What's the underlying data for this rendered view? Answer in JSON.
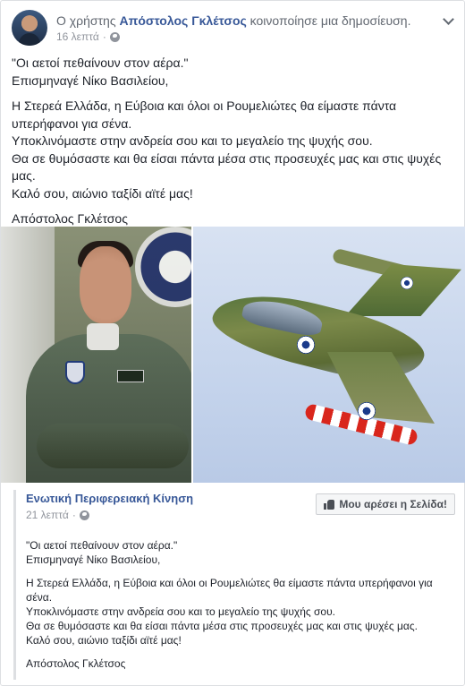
{
  "post": {
    "prefix": "Ο χρήστης ",
    "author": "Απόστολος Γκλέτσος",
    "action": " κοινοποίησε μια δημοσίευση.",
    "time": "16 λεπτά",
    "dot": "·",
    "paragraphs": [
      [
        "\"Οι αετοί πεθαίνουν στον αέρα.\"",
        "Επισμηναγέ Νίκο Βασιλείου,"
      ],
      [
        "Η Στερεά Ελλάδα, η Εύβοια και όλοι οι Ρουμελιώτες θα είμαστε πάντα",
        "υπερήφανοι για σένα.",
        "Υποκλινόμαστε στην ανδρεία σου και το μεγαλείο της ψυχής σου.",
        "Θα σε θυμόσαστε και θα είσαι πάντα μέσα στις προσευχές μας και στις ψυχές",
        "μας.",
        "Καλό σου, αιώνιο ταξίδι αϊτέ μας!"
      ],
      [
        "Απόστολος Γκλέτσος"
      ]
    ]
  },
  "shared": {
    "page_name": "Ενωτική Περιφερειακή Κίνηση",
    "time": "21 λεπτά",
    "dot": "·",
    "like_button_label": "Μου αρέσει η Σελίδα!",
    "paragraphs": [
      [
        "\"Οι αετοί πεθαίνουν στον αέρα.\"",
        "Επισμηναγέ Νίκο Βασιλείου,"
      ],
      [
        "Η Στερεά Ελλάδα, η Εύβοια και όλοι οι Ρουμελιώτες θα είμαστε πάντα υπερήφανοι για",
        "σένα.",
        "Υποκλινόμαστε στην ανδρεία σου και το μεγαλείο της ψυχής σου.",
        "Θα σε θυμόσαστε και θα είσαι πάντα μέσα στις προσευχές μας και στις ψυχές μας.",
        "Καλό σου, αιώνιο ταξίδι αϊτέ μας!"
      ],
      [
        "Απόστολος Γκλέτσος"
      ]
    ]
  },
  "icons": {
    "avatar": "avatar",
    "audience": "globe-icon",
    "menu": "chevron-down-icon",
    "like": "thumb-up-icon"
  },
  "colors": {
    "link": "#385898",
    "muted": "#90949c",
    "text": "#1d2129",
    "border": "#dddfe2"
  }
}
